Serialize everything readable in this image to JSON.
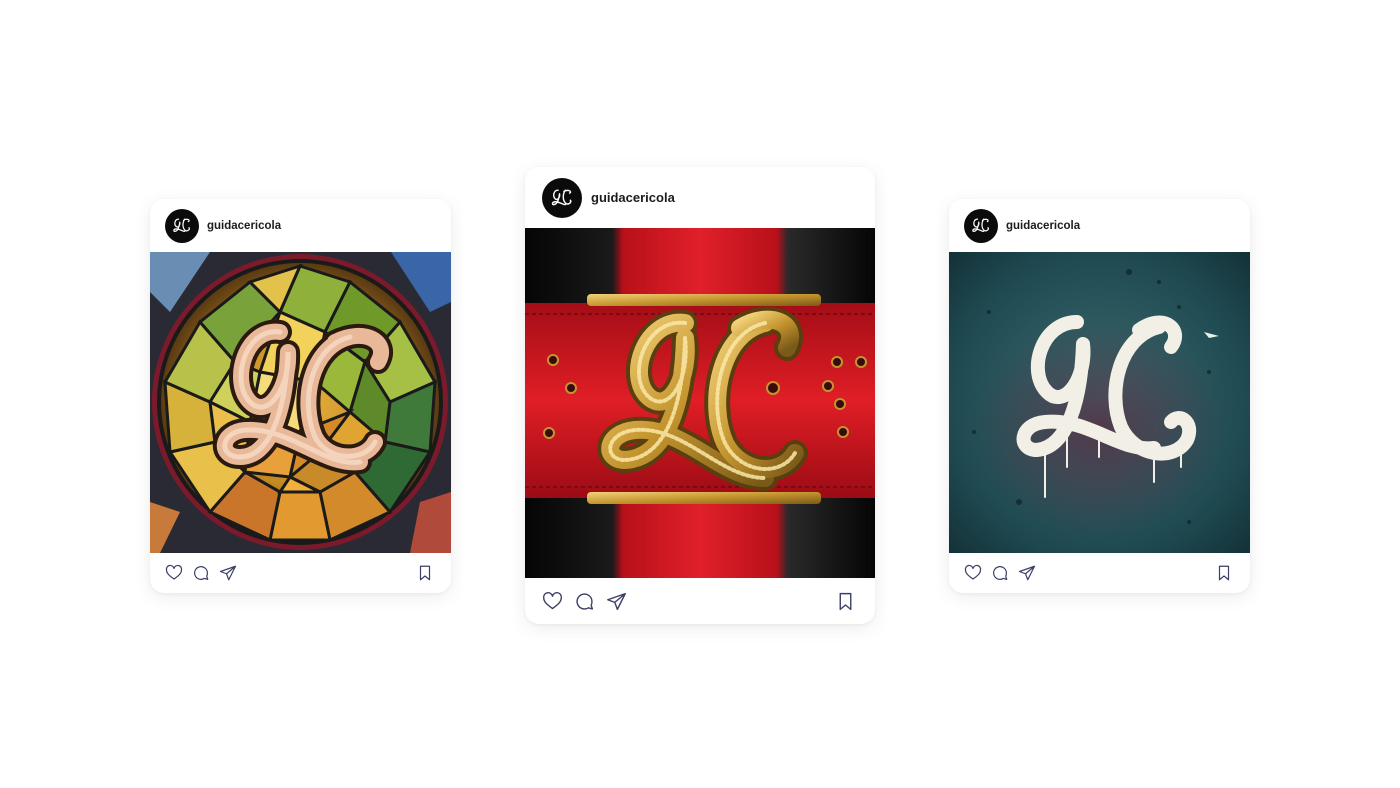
{
  "colors": {
    "background": "#ffffff",
    "icon_stroke": "#3b3f66",
    "avatar_bg": "#0b0b0b"
  },
  "posts": [
    {
      "username": "guidacericola",
      "image_subject": "stained-glass GC monogram",
      "actions": [
        "heart-icon",
        "comment-icon",
        "share-icon",
        "bookmark-icon"
      ]
    },
    {
      "username": "guidacericola",
      "image_subject": "gold GC buckle on red leather belt",
      "actions": [
        "heart-icon",
        "comment-icon",
        "share-icon",
        "bookmark-icon"
      ]
    },
    {
      "username": "guidacericola",
      "image_subject": "white spray-painted GC graffiti on teal wall",
      "actions": [
        "heart-icon",
        "comment-icon",
        "share-icon",
        "bookmark-icon"
      ]
    }
  ]
}
